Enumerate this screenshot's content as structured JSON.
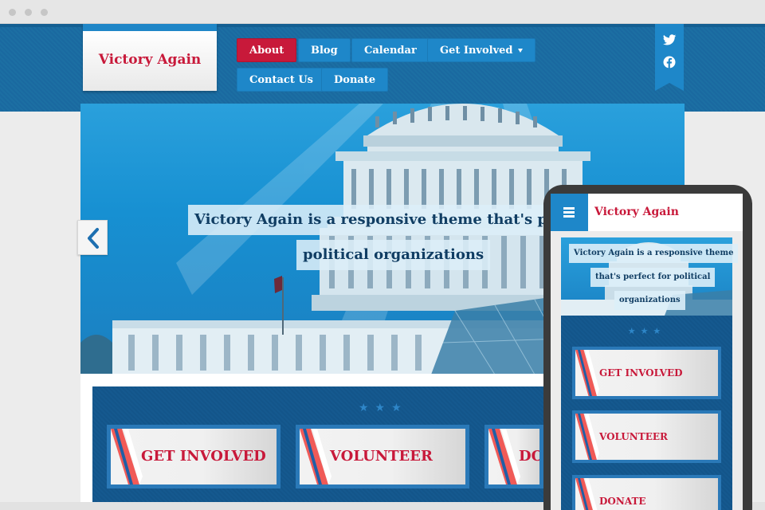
{
  "site": {
    "logo": "Victory Again"
  },
  "nav": {
    "items": [
      {
        "label": "About",
        "active": true
      },
      {
        "label": "Blog"
      },
      {
        "label": "Calendar"
      },
      {
        "label": "Get Involved",
        "dropdown": true
      },
      {
        "label": "Contact Us"
      },
      {
        "label": "Donate"
      }
    ]
  },
  "social": {
    "icons": [
      "twitter-icon",
      "facebook-icon"
    ]
  },
  "hero": {
    "caption_line1": "Victory Again is a responsive theme that's perfect",
    "caption_line2": "political organizations"
  },
  "features": {
    "stars": "★★★",
    "cards": [
      "GET INVOLVED",
      "VOLUNTEER",
      "DONATE"
    ]
  },
  "mobile": {
    "logo": "Victory Again",
    "caption_line1": "Victory Again is a responsive theme",
    "caption_line2": "that's perfect for political",
    "caption_line3": "organizations",
    "stars": "★★★",
    "cards": [
      "GET INVOLVED",
      "VOLUNTEER",
      "DONATE"
    ]
  },
  "colors": {
    "brand_red": "#c8193a",
    "brand_blue": "#1e87c9",
    "navy": "#15598f"
  }
}
